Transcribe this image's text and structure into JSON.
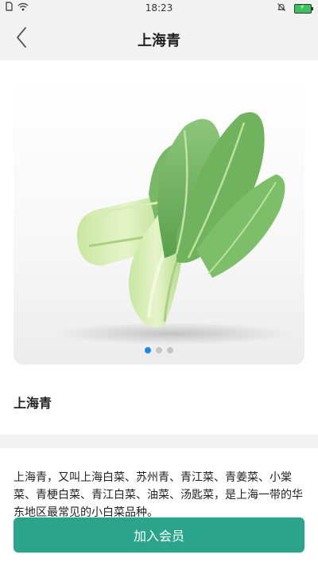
{
  "status_bar": {
    "time": "18:23",
    "icons": [
      "sim-icon",
      "wifi-icon",
      "bell-muted-icon",
      "battery-charging-icon"
    ]
  },
  "header": {
    "title": "上海青",
    "back_icon": "chevron-left-icon"
  },
  "product": {
    "image_subject": "bok-choy-photo",
    "carousel": {
      "count": 3,
      "active_index": 0
    },
    "name": "上海青",
    "description": "上海青，又叫上海白菜、苏州青、青江菜、青姜菜、小棠菜、青梗白菜、青江白菜、油菜、汤匙菜，是上海一带的华东地区最常见的小白菜品种。"
  },
  "actions": {
    "join_label": "加入会员"
  },
  "colors": {
    "accent": "#2aa58c",
    "active_dot": "#1e88e5",
    "inactive_dot": "#c6c6c6",
    "background": "#f2f2f2"
  }
}
